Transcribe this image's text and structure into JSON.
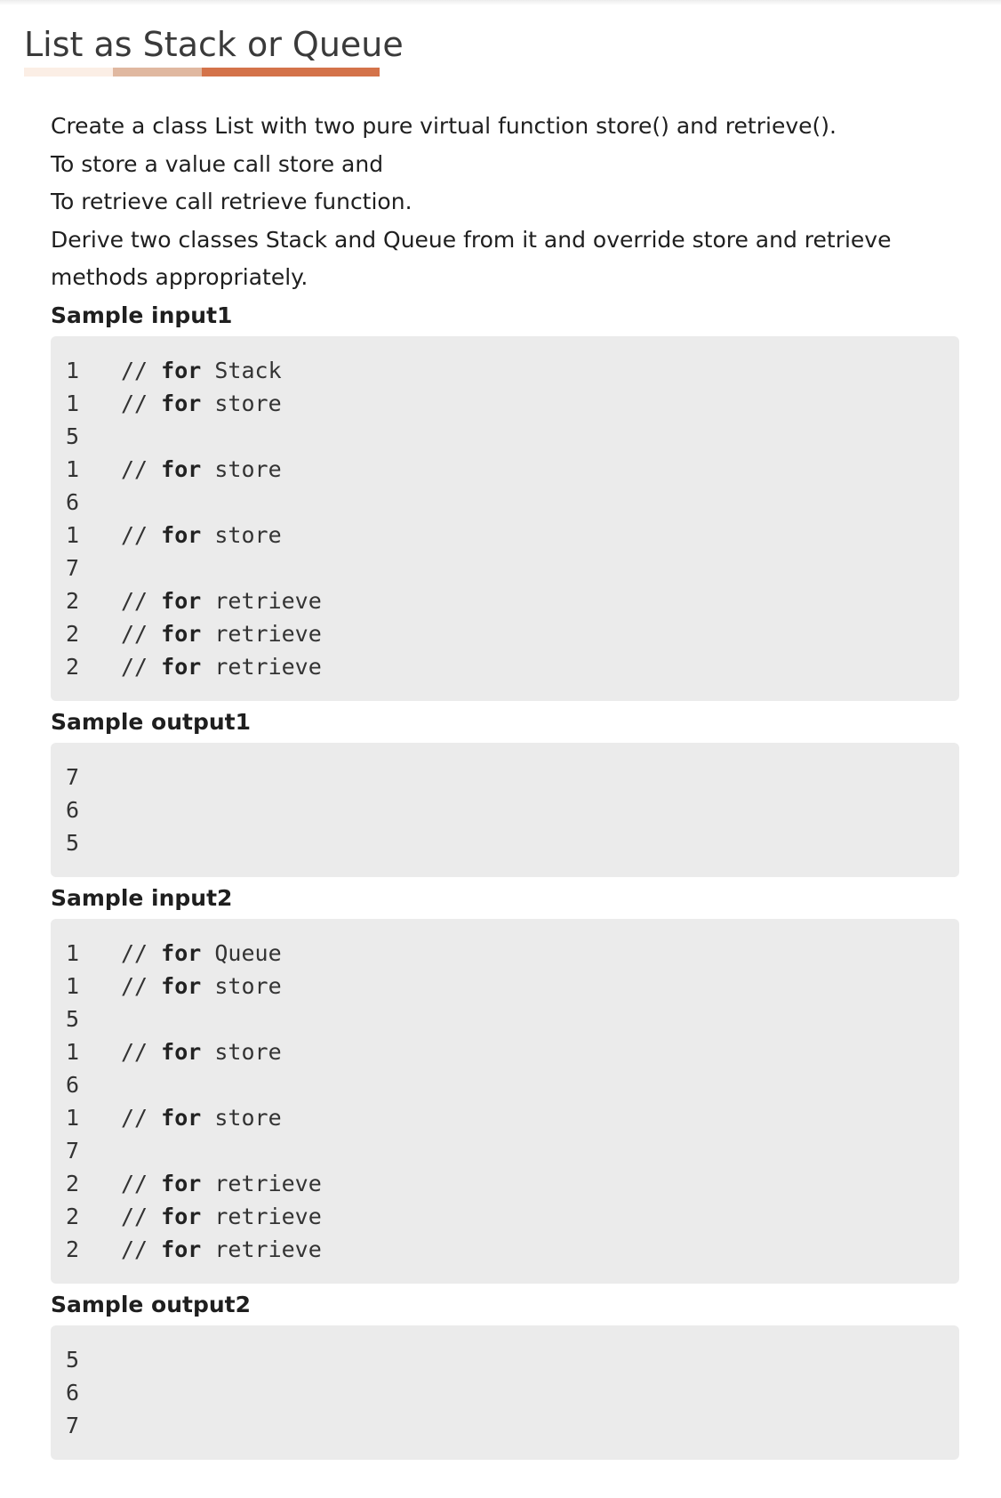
{
  "title": "List as Stack or Queue",
  "underline_colors": [
    "#fbeee5",
    "#e0b8a0",
    "#d4734a"
  ],
  "description": [
    "Create a class List with two pure virtual function store() and retrieve().",
    "To store a value call store and",
    "To retrieve call retrieve function.",
    "Derive two classes Stack and Queue from it and override store and retrieve methods appropriately."
  ],
  "sample_input1": {
    "label": "Sample input1",
    "lines": [
      {
        "value": "1",
        "comment_prefix": "// ",
        "keyword": "for",
        "comment_rest": " Stack"
      },
      {
        "value": "1",
        "comment_prefix": "// ",
        "keyword": "for",
        "comment_rest": " store"
      },
      {
        "value": "5",
        "comment_prefix": "",
        "keyword": "",
        "comment_rest": ""
      },
      {
        "value": "1",
        "comment_prefix": "// ",
        "keyword": "for",
        "comment_rest": " store"
      },
      {
        "value": "6",
        "comment_prefix": "",
        "keyword": "",
        "comment_rest": ""
      },
      {
        "value": "1",
        "comment_prefix": "// ",
        "keyword": "for",
        "comment_rest": " store"
      },
      {
        "value": "7",
        "comment_prefix": "",
        "keyword": "",
        "comment_rest": ""
      },
      {
        "value": "2",
        "comment_prefix": "// ",
        "keyword": "for",
        "comment_rest": " retrieve"
      },
      {
        "value": "2",
        "comment_prefix": "// ",
        "keyword": "for",
        "comment_rest": " retrieve"
      },
      {
        "value": "2",
        "comment_prefix": "// ",
        "keyword": "for",
        "comment_rest": " retrieve"
      }
    ]
  },
  "sample_output1": {
    "label": "Sample output1",
    "lines": [
      "7",
      "6",
      "5"
    ]
  },
  "sample_input2": {
    "label": "Sample input2",
    "lines": [
      {
        "value": "1",
        "comment_prefix": "// ",
        "keyword": "for",
        "comment_rest": " Queue"
      },
      {
        "value": "1",
        "comment_prefix": "// ",
        "keyword": "for",
        "comment_rest": " store"
      },
      {
        "value": "5",
        "comment_prefix": "",
        "keyword": "",
        "comment_rest": ""
      },
      {
        "value": "1",
        "comment_prefix": "// ",
        "keyword": "for",
        "comment_rest": " store"
      },
      {
        "value": "6",
        "comment_prefix": "",
        "keyword": "",
        "comment_rest": ""
      },
      {
        "value": "1",
        "comment_prefix": "// ",
        "keyword": "for",
        "comment_rest": " store"
      },
      {
        "value": "7",
        "comment_prefix": "",
        "keyword": "",
        "comment_rest": ""
      },
      {
        "value": "2",
        "comment_prefix": "// ",
        "keyword": "for",
        "comment_rest": " retrieve"
      },
      {
        "value": "2",
        "comment_prefix": "// ",
        "keyword": "for",
        "comment_rest": " retrieve"
      },
      {
        "value": "2",
        "comment_prefix": "// ",
        "keyword": "for",
        "comment_rest": " retrieve"
      }
    ]
  },
  "sample_output2": {
    "label": "Sample output2",
    "lines": [
      "5",
      "6",
      "7"
    ]
  }
}
